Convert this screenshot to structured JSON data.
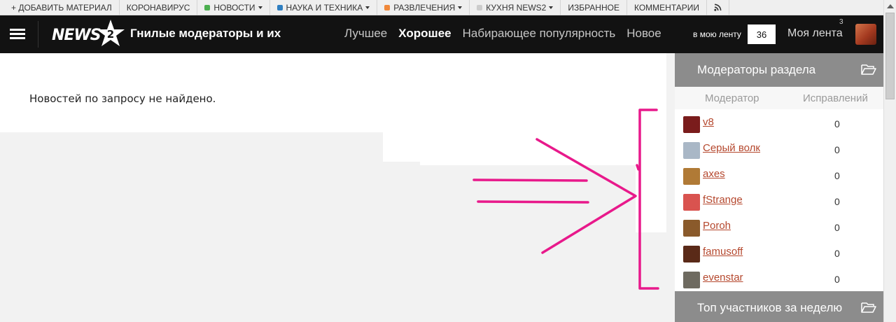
{
  "topbar": {
    "items": [
      {
        "label": "+ ДОБАВИТЬ МАТЕРИАЛ",
        "dot": null,
        "caret": false
      },
      {
        "label": "КОРОНАВИРУС",
        "dot": null,
        "caret": false
      },
      {
        "label": "НОВОСТИ",
        "dot": "#4caf50",
        "caret": true
      },
      {
        "label": "НАУКА И ТЕХНИКА",
        "dot": "#2f7fc1",
        "caret": true
      },
      {
        "label": "РАЗВЛЕЧЕНИЯ",
        "dot": "#f0883a",
        "caret": true
      },
      {
        "label": "КУХНЯ NEWS2",
        "dot": "#cccccc",
        "caret": true
      },
      {
        "label": "ИЗБРАННОЕ",
        "dot": null,
        "caret": false
      },
      {
        "label": "КОММЕНТАРИИ",
        "dot": null,
        "caret": false
      }
    ],
    "rss_icon": "rss-icon"
  },
  "header": {
    "menu_icon": "hamburger-icon",
    "logo_text": "NEWS",
    "logo_badge": "2",
    "page_title": "Гнилые модераторы и их",
    "nav": [
      {
        "label": "Лучшее",
        "active": false
      },
      {
        "label": "Хорошее",
        "active": true
      },
      {
        "label": "Набирающее популярность",
        "active": false
      },
      {
        "label": "Новое",
        "active": false
      }
    ],
    "feed_label": "в мою ленту",
    "feed_count": "36",
    "my_feed_label": "Моя лента",
    "notification_count": "3"
  },
  "content": {
    "no_results": "Новостей по запросу не найдено."
  },
  "sidebar": {
    "moderators_title": "Модераторы раздела",
    "col_moderator": "Модератор",
    "col_edits": "Исправлений",
    "moderators": [
      {
        "name": "v8",
        "edits": "0",
        "avatar_color": "#7a1c1c"
      },
      {
        "name": "Серый волк",
        "edits": "0",
        "avatar_color": "#a9b7c6"
      },
      {
        "name": "axes",
        "edits": "0",
        "avatar_color": "#b07a36"
      },
      {
        "name": "fStrange",
        "edits": "0",
        "avatar_color": "#d9534f"
      },
      {
        "name": "Poroh",
        "edits": "0",
        "avatar_color": "#8a5a2b"
      },
      {
        "name": "famusoff",
        "edits": "0",
        "avatar_color": "#5a2a18"
      },
      {
        "name": "evenstar",
        "edits": "0",
        "avatar_color": "#6e6a60"
      }
    ],
    "top_title": "Топ участников за неделю",
    "folder_icon": "folder-open-icon"
  },
  "colors": {
    "header_bg": "#121212",
    "sidebar_header_bg": "#8c8c8c",
    "link_color": "#b5482e",
    "annotation_color": "#e8198b"
  }
}
